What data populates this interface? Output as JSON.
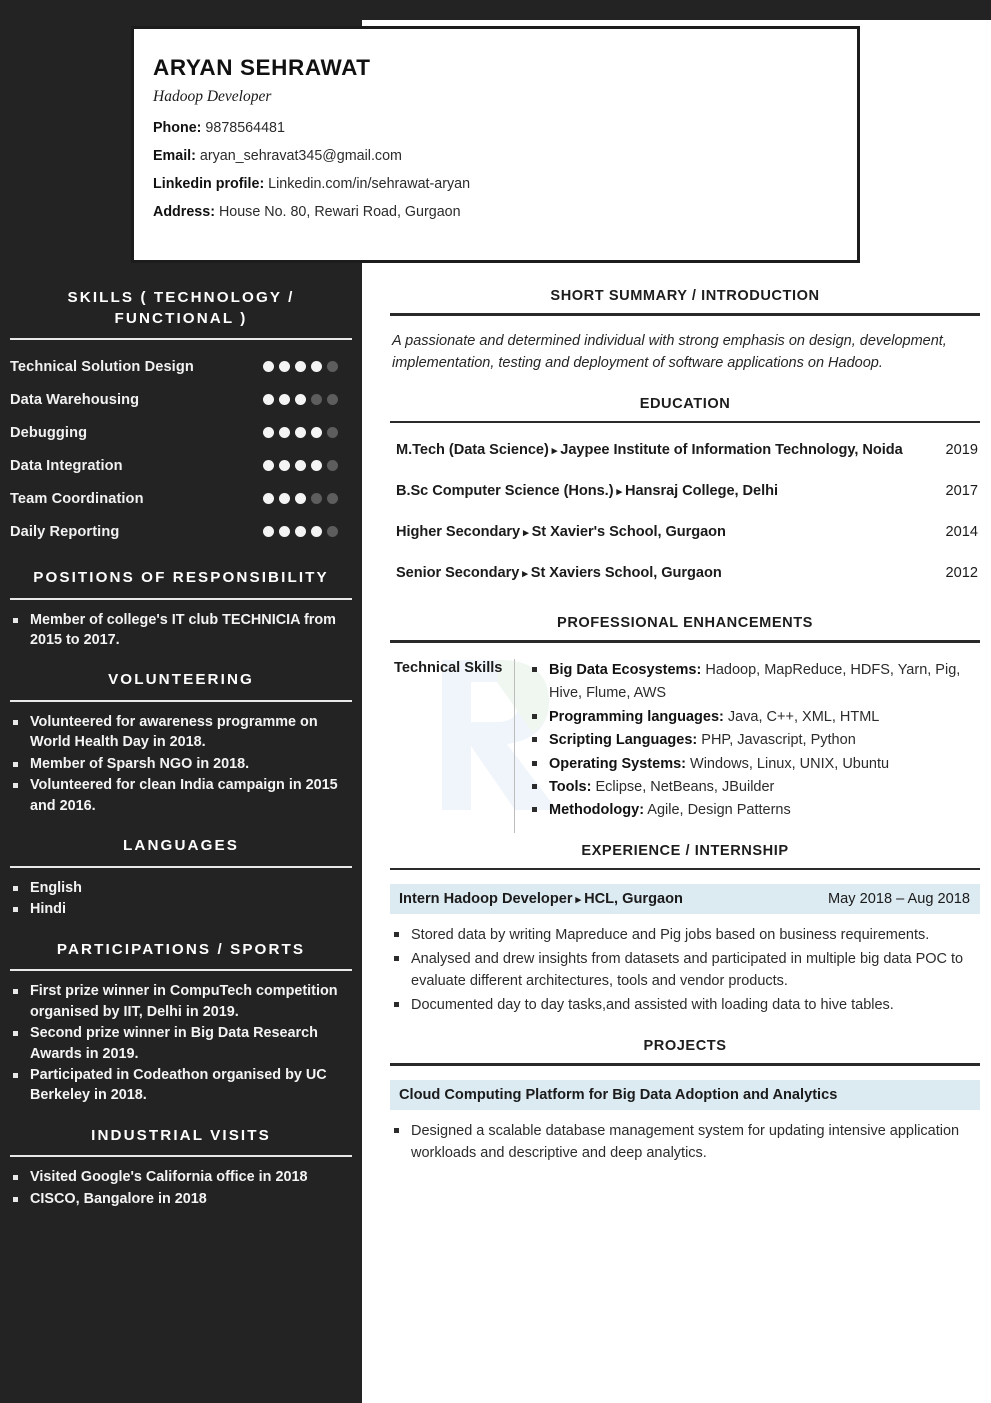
{
  "theme": {
    "sidebar_bg": "#232323",
    "page_bg": "#ffffff",
    "highlight_bar": "#dceaf2",
    "rule_dark": "#2a2a2a",
    "dot_on": "#f4f4f4",
    "dot_off": "#5d5d5d"
  },
  "header": {
    "name": "ARYAN SEHRAWAT",
    "role": "Hadoop Developer",
    "contacts": [
      {
        "label": "Phone:",
        "value": "9878564481"
      },
      {
        "label": "Email:",
        "value": "aryan_sehravat345@gmail.com"
      },
      {
        "label": "Linkedin profile:",
        "value": "Linkedin.com/in/sehrawat-aryan"
      },
      {
        "label": "Address:",
        "value": "House No. 80, Rewari Road, Gurgaon"
      }
    ]
  },
  "sidebar": {
    "skills_heading": "SKILLS ( TECHNOLOGY / FUNCTIONAL )",
    "skills": [
      {
        "name": "Technical Solution Design",
        "rating": 4,
        "max": 5
      },
      {
        "name": "Data Warehousing",
        "rating": 3,
        "max": 5
      },
      {
        "name": "Debugging",
        "rating": 4,
        "max": 5
      },
      {
        "name": "Data Integration",
        "rating": 4,
        "max": 5
      },
      {
        "name": "Team Coordination",
        "rating": 3,
        "max": 5
      },
      {
        "name": "Daily Reporting",
        "rating": 4,
        "max": 5
      }
    ],
    "positions_heading": "POSITIONS OF RESPONSIBILITY",
    "positions": [
      "Member of college's IT club TECHNICIA from 2015 to 2017."
    ],
    "volunteering_heading": "VOLUNTEERING",
    "volunteering": [
      "Volunteered for awareness programme on World Health Day in 2018.",
      "Member of Sparsh NGO in 2018.",
      "Volunteered for clean India campaign in 2015 and 2016."
    ],
    "languages_heading": "LANGUAGES",
    "languages": [
      "English",
      "Hindi"
    ],
    "participations_heading": "PARTICIPATIONS / SPORTS",
    "participations": [
      "First prize winner in CompuTech competition organised by IIT, Delhi in 2019.",
      "Second prize winner in Big Data Research Awards in 2019.",
      "Participated in Codeathon organised by UC Berkeley in 2018."
    ],
    "visits_heading": "INDUSTRIAL VISITS",
    "visits": [
      "Visited Google's California office in 2018",
      "CISCO, Bangalore in 2018"
    ]
  },
  "main": {
    "summary_heading": "SHORT SUMMARY / INTRODUCTION",
    "summary_text": "A passionate and determined individual with strong emphasis on design, development, implementation, testing and deployment of software applications on Hadoop.",
    "education_heading": "EDUCATION",
    "education": [
      {
        "degree": "M.Tech (Data Science)",
        "sep": "▸",
        "institute": "Jaypee Institute of Information Technology, Noida",
        "year": "2019"
      },
      {
        "degree": "B.Sc Computer Science (Hons.)",
        "sep": "▸",
        "institute": "Hansraj College, Delhi",
        "year": "2017"
      },
      {
        "degree": "Higher Secondary",
        "sep": "▸",
        "institute": "St Xavier's School, Gurgaon",
        "year": "2014"
      },
      {
        "degree": "Senior Secondary",
        "sep": "▸",
        "institute": "St Xaviers School, Gurgaon",
        "year": "2012"
      }
    ],
    "enhancements_heading": "PROFESSIONAL ENHANCEMENTS",
    "enhancements_label": "Technical Skills",
    "enhancements": [
      {
        "label": "Big Data Ecosystems:",
        "value": " Hadoop, MapReduce, HDFS, Yarn, Pig, Hive, Flume, AWS"
      },
      {
        "label": "Programming languages:",
        "value": " Java, C++, XML, HTML"
      },
      {
        "label": "Scripting Languages:",
        "value": " PHP, Javascript, Python"
      },
      {
        "label": "Operating Systems:",
        "value": " Windows, Linux, UNIX, Ubuntu"
      },
      {
        "label": "Tools:",
        "value": " Eclipse, NetBeans, JBuilder"
      },
      {
        "label": "Methodology:",
        "value": " Agile, Design Patterns"
      }
    ],
    "experience_heading": "EXPERIENCE / INTERNSHIP",
    "experience": {
      "role": "Intern Hadoop Developer",
      "sep": "▸",
      "company": "HCL, Gurgaon",
      "dates": "May 2018 – Aug 2018",
      "bullets": [
        "Stored data by writing Mapreduce and Pig jobs based on business requirements.",
        "Analysed and drew insights from datasets and participated in multiple big data POC to evaluate different architectures, tools and vendor products.",
        "Documented day to day tasks,and assisted with loading data to hive tables."
      ]
    },
    "projects_heading": "PROJECTS",
    "projects": [
      {
        "title": "Cloud Computing Platform for Big Data Adoption and Analytics",
        "bullets": [
          "Designed a scalable database management system for updating intensive application workloads and descriptive and deep analytics."
        ]
      }
    ]
  }
}
